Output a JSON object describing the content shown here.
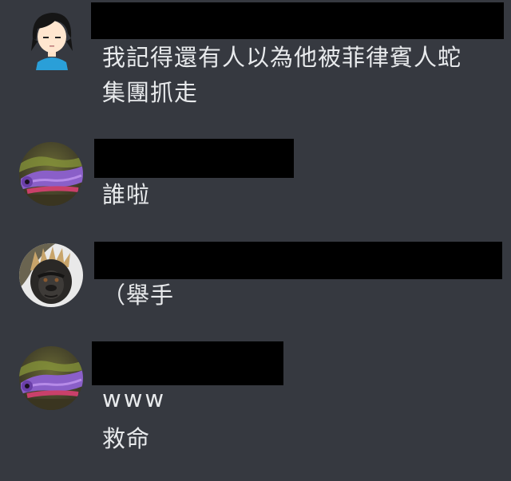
{
  "messages": [
    {
      "avatar": "cartoon-boy-avatar",
      "author_redacted": true,
      "lines": [
        "我記得還有人以為他被菲律賓人蛇",
        "集團抓走"
      ]
    },
    {
      "avatar": "purple-caterpillar-avatar",
      "author_redacted": true,
      "lines": [
        "誰啦"
      ]
    },
    {
      "avatar": "gorilla-avatar",
      "author_redacted": true,
      "lines": [
        "（舉手"
      ]
    },
    {
      "avatar": "purple-caterpillar-avatar",
      "author_redacted": true,
      "lines": [
        "www",
        "救命"
      ]
    }
  ],
  "colors": {
    "background": "#363940",
    "text": "#e8eaec",
    "redaction": "#000000"
  }
}
